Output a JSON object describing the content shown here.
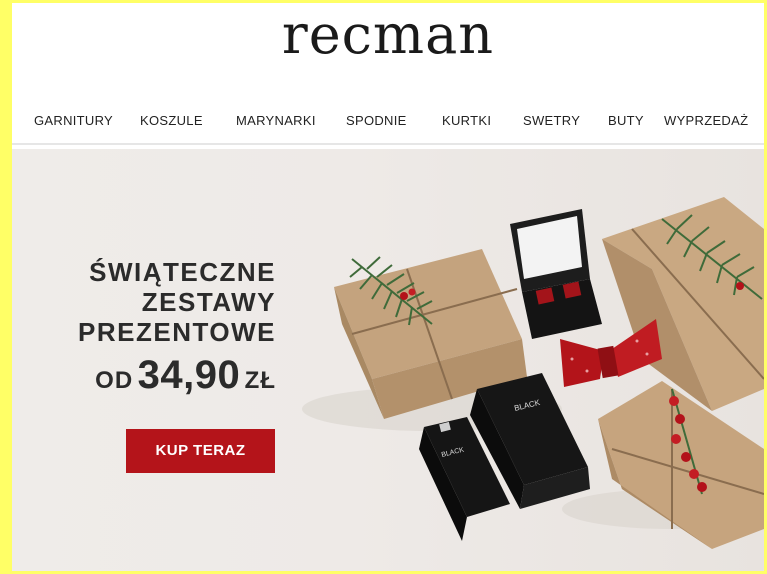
{
  "brand": {
    "logo_text": "RECMAN"
  },
  "nav": {
    "items": [
      {
        "label": "GARNITURY"
      },
      {
        "label": "KOSZULE"
      },
      {
        "label": "MARYNARKI"
      },
      {
        "label": "SPODNIE"
      },
      {
        "label": "KURTKI"
      },
      {
        "label": "SWETRY"
      },
      {
        "label": "BUTY"
      },
      {
        "label": "WYPRZEDAŻ"
      }
    ]
  },
  "hero": {
    "headline_lines": [
      "ŚWIĄTECZNE",
      "ZESTAWY",
      "PREZENTOWE"
    ],
    "price_prefix": "OD",
    "price_value": "34,90",
    "price_currency": "ZŁ",
    "cta_label": "KUP TERAZ",
    "perfume_box_text": "BLACK",
    "perfume_bottle_text": "BLACK"
  },
  "colors": {
    "page_border": "#ffff66",
    "cta_background": "#b4141a",
    "text_dark": "#2b2b2b",
    "hero_background": "#eeeae7"
  }
}
